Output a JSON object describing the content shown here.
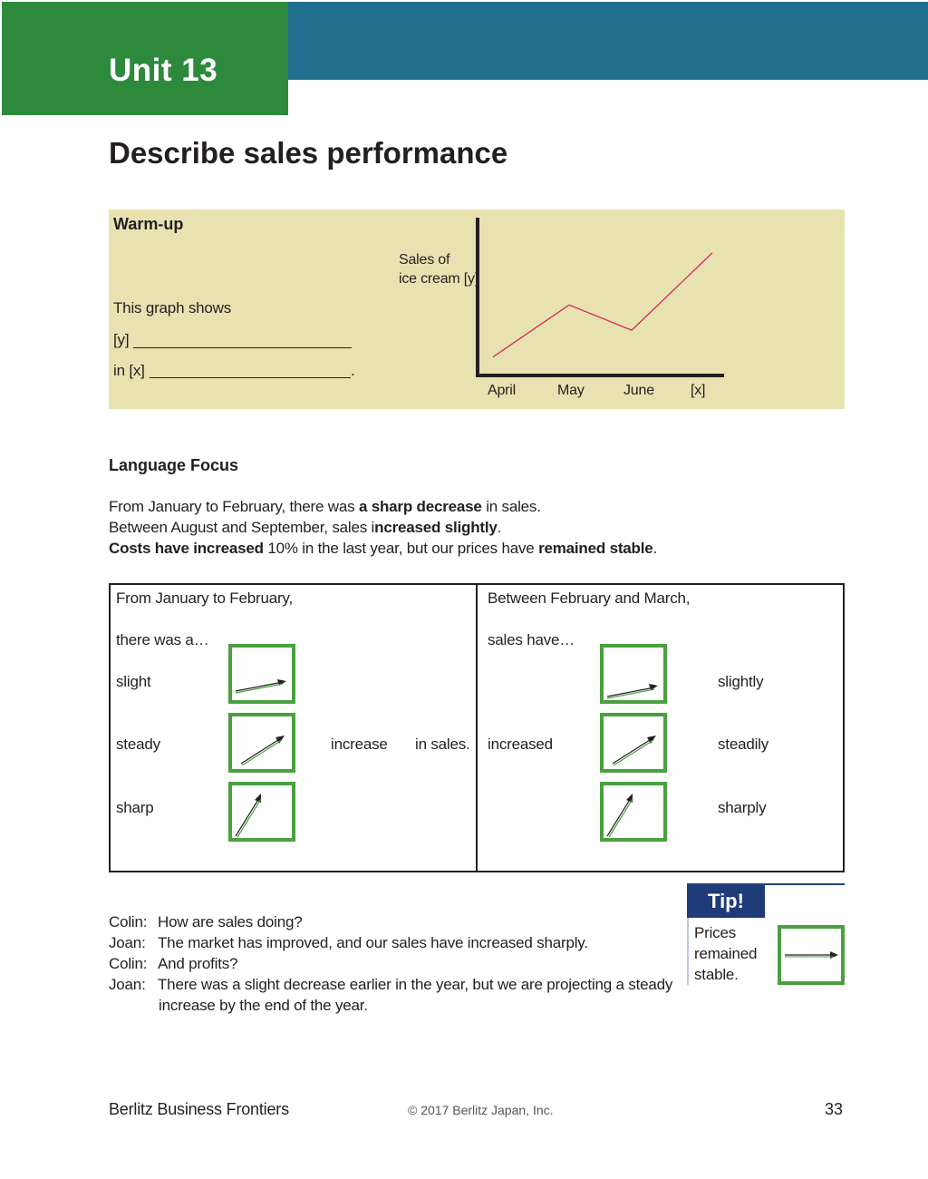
{
  "header": {
    "unit": "Unit 13",
    "title": "Describe sales performance"
  },
  "warmup": {
    "heading": "Warm-up",
    "line1": "This graph shows",
    "line2_prefix": "[y]",
    "line3_prefix": "in [x]",
    "line3_suffix": ".",
    "chart": {
      "ylabel_line1": "Sales of",
      "ylabel_line2": "ice cream [y]",
      "categories": [
        "April",
        "May",
        "June",
        "[x]"
      ],
      "line_color": "#d6245c"
    }
  },
  "chart_data": {
    "type": "line",
    "title": "",
    "xlabel": "",
    "ylabel": "Sales of ice cream [y]",
    "categories": [
      "April",
      "May",
      "June",
      "[x]"
    ],
    "series": [
      {
        "values": [
          1.0,
          4.5,
          2.8,
          8.0
        ]
      }
    ],
    "ylim": [
      0,
      10
    ],
    "grid": false,
    "note": "no numeric y ticks shown; values are relative estimates"
  },
  "language_focus": {
    "heading": "Language Focus",
    "s1_a": "From January to February, there was ",
    "s1_b": "a sharp decrease",
    "s1_c": " in sales.",
    "s2_a": "Between August and September, sales i",
    "s2_b": "ncreased slightly",
    "s2_c": ".",
    "s3_a": "Costs have increased",
    "s3_b": " 10% in the last year, but our prices have ",
    "s3_c": "remained stable",
    "s3_d": "."
  },
  "table": {
    "left_intro": "From January to February,",
    "left_there": "there was a…",
    "left_words": [
      "slight",
      "steady",
      "sharp"
    ],
    "left_noun": "increase",
    "left_end": "in sales.",
    "right_intro": "Between February and March,",
    "right_have": "sales have…",
    "right_verb": "increased",
    "right_words": [
      "slightly",
      "steadily",
      "sharply"
    ],
    "arrow_color": "#4aa03f"
  },
  "tip": {
    "badge": "Tip!",
    "line1": "Prices",
    "line2": "remained",
    "line3": "stable."
  },
  "dialogue": [
    {
      "speaker": "Colin:",
      "text": "How are sales doing?"
    },
    {
      "speaker": "Joan:",
      "text": "The market has improved, and our sales have increased sharply."
    },
    {
      "speaker": "Colin:",
      "text": "And profits?"
    },
    {
      "speaker": "Joan:",
      "text": "There was a slight decrease earlier in the year, but we are projecting a steady"
    }
  ],
  "dialogue_continuation": "increase by the end of the year.",
  "footer": {
    "left": "Berlitz Business Frontiers",
    "center": "© 2017 Berlitz Japan, Inc.",
    "page": "33"
  }
}
